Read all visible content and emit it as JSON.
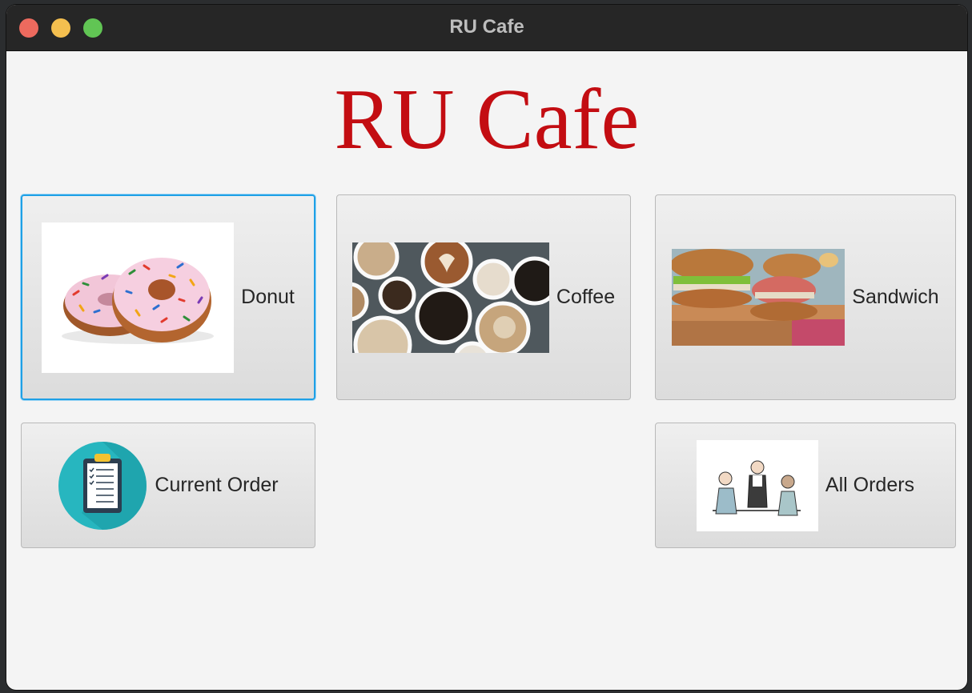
{
  "window": {
    "title": "RU Cafe"
  },
  "header": {
    "title": "RU Cafe"
  },
  "tiles": {
    "donut": {
      "label": "Donut"
    },
    "coffee": {
      "label": "Coffee"
    },
    "sandwich": {
      "label": "Sandwich"
    },
    "current_order": {
      "label": "Current Order"
    },
    "all_orders": {
      "label": "All Orders"
    }
  },
  "colors": {
    "brand_red": "#c30d12",
    "focus_blue": "#1ea0e6"
  },
  "icons": [
    "donut-image",
    "coffee-image",
    "sandwich-image",
    "clipboard-icon",
    "waiter-customers-image"
  ]
}
